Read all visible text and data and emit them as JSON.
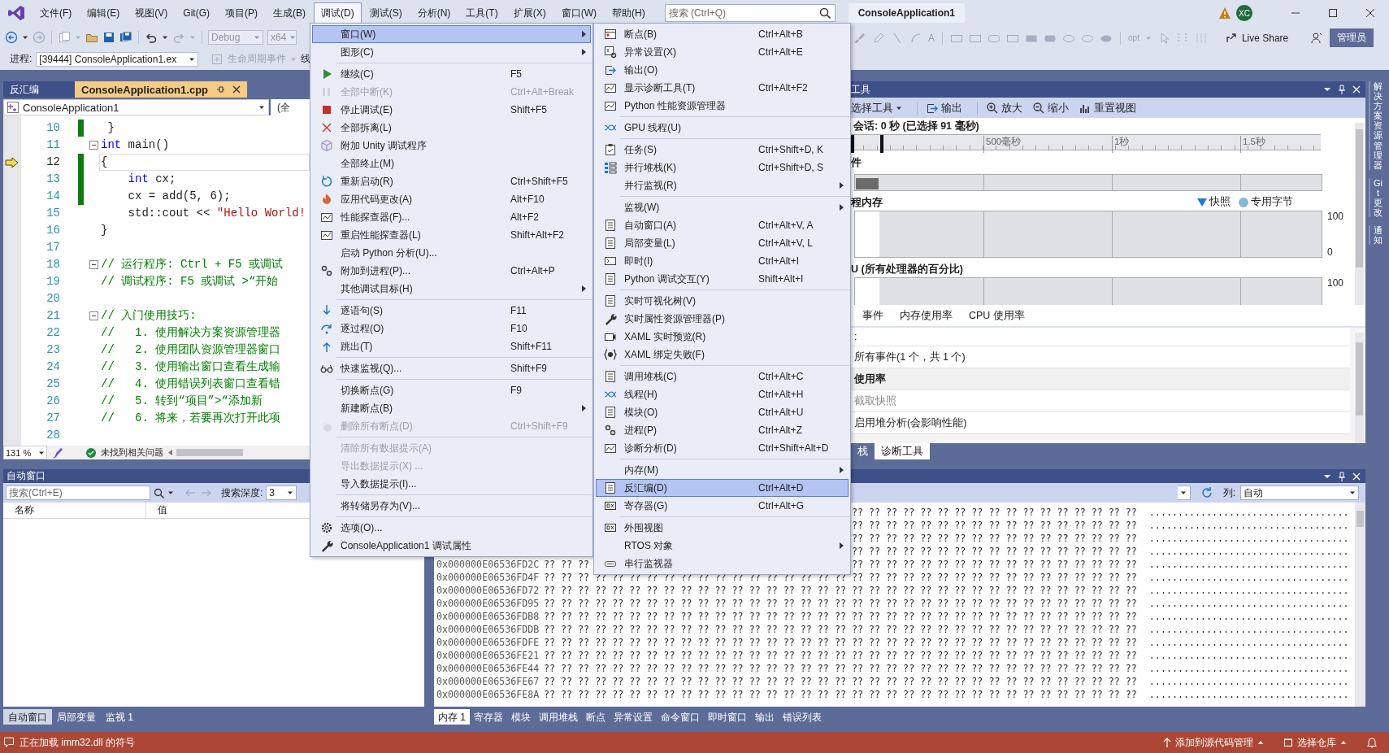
{
  "menubar": {
    "items": [
      {
        "label": "文件(F)",
        "selected": false
      },
      {
        "label": "编辑(E)",
        "selected": false
      },
      {
        "label": "视图(V)",
        "selected": false
      },
      {
        "label": "Git(G)",
        "selected": false
      },
      {
        "label": "项目(P)",
        "selected": false
      },
      {
        "label": "生成(B)",
        "selected": false
      },
      {
        "label": "调试(D)",
        "selected": true
      },
      {
        "label": "测试(S)",
        "selected": false
      },
      {
        "label": "分析(N)",
        "selected": false
      },
      {
        "label": "工具(T)",
        "selected": false
      },
      {
        "label": "扩展(X)",
        "selected": false
      },
      {
        "label": "窗口(W)",
        "selected": false
      },
      {
        "label": "帮助(H)",
        "selected": false
      }
    ],
    "search": {
      "placeholder": "搜索 (Ctrl+Q)"
    },
    "title": "ConsoleApplication1",
    "avatar": "XC"
  },
  "toolbar": {
    "configuration": {
      "value": "Debug",
      "disabled": true
    },
    "platform": {
      "value": "x64",
      "disabled": true
    },
    "design_letter": "A",
    "design_option": "opt",
    "live_share": "Live Share",
    "admin": "管理员",
    "process_label": "进程:",
    "process": "[39444] ConsoleApplication1.ex",
    "lifecycle": "生命周期事件",
    "thread_label": "线"
  },
  "editor": {
    "tabs": [
      {
        "label": "反汇编",
        "selected": false
      },
      {
        "label": "ConsoleApplication1.cpp",
        "selected": true
      }
    ],
    "scope": "ConsoleApplication1",
    "scope_2": "(全",
    "lines": [
      {
        "number": "10",
        "changed": true,
        "fold": false,
        "current": false,
        "tokens": [
          {
            "kind": "plain",
            "text": " }"
          }
        ]
      },
      {
        "number": "11",
        "changed": false,
        "fold": true,
        "current": false,
        "tokens": [
          {
            "kind": "keyword",
            "text": "int"
          },
          {
            "kind": "plain",
            "text": " main()"
          }
        ]
      },
      {
        "number": "12",
        "changed": true,
        "fold": false,
        "current": true,
        "tokens": [
          {
            "kind": "plain",
            "text": "{"
          }
        ]
      },
      {
        "number": "13",
        "changed": true,
        "fold": false,
        "current": false,
        "tokens": [
          {
            "kind": "keyword",
            "text": "    int"
          },
          {
            "kind": "plain",
            "text": " cx;"
          }
        ]
      },
      {
        "number": "14",
        "changed": true,
        "fold": false,
        "current": false,
        "tokens": [
          {
            "kind": "plain",
            "text": "    cx = add(5, 6);"
          }
        ]
      },
      {
        "number": "15",
        "changed": false,
        "fold": false,
        "current": false,
        "tokens": [
          {
            "kind": "plain",
            "text": "    std::cout << "
          },
          {
            "kind": "string",
            "text": "\"Hello World!"
          }
        ]
      },
      {
        "number": "16",
        "changed": false,
        "fold": false,
        "current": false,
        "tokens": [
          {
            "kind": "plain",
            "text": "}"
          }
        ]
      },
      {
        "number": "17",
        "changed": false,
        "fold": false,
        "current": false
      },
      {
        "number": "18",
        "changed": false,
        "fold": true,
        "current": false,
        "tokens": [
          {
            "kind": "comment",
            "text": "// 运行程序: Ctrl + F5 或调试"
          }
        ]
      },
      {
        "number": "19",
        "changed": false,
        "fold": false,
        "current": false,
        "tokens": [
          {
            "kind": "comment",
            "text": "// 调试程序: F5 或调试 >“开始"
          }
        ]
      },
      {
        "number": "20",
        "changed": false,
        "fold": false,
        "current": false
      },
      {
        "number": "21",
        "changed": false,
        "fold": true,
        "current": false,
        "tokens": [
          {
            "kind": "comment",
            "text": "// 入门使用技巧:"
          }
        ]
      },
      {
        "number": "22",
        "changed": false,
        "fold": false,
        "current": false,
        "tokens": [
          {
            "kind": "comment",
            "text": "//   1. 使用解决方案资源管理器"
          }
        ]
      },
      {
        "number": "23",
        "changed": false,
        "fold": false,
        "current": false,
        "tokens": [
          {
            "kind": "comment",
            "text": "//   2. 使用团队资源管理器窗口"
          }
        ]
      },
      {
        "number": "24",
        "changed": false,
        "fold": false,
        "current": false,
        "tokens": [
          {
            "kind": "comment",
            "text": "//   3. 使用输出窗口查看生成输"
          }
        ]
      },
      {
        "number": "25",
        "changed": false,
        "fold": false,
        "current": false,
        "tokens": [
          {
            "kind": "comment",
            "text": "//   4. 使用错误列表窗口查看错"
          }
        ]
      },
      {
        "number": "26",
        "changed": false,
        "fold": false,
        "current": false,
        "tokens": [
          {
            "kind": "comment",
            "text": "//   5. 转到“项目”>“添加新"
          }
        ]
      },
      {
        "number": "27",
        "changed": false,
        "fold": false,
        "current": false,
        "tokens": [
          {
            "kind": "comment",
            "text": "//   6. 将来，若要再次打开此项"
          }
        ]
      },
      {
        "number": "28",
        "changed": false,
        "fold": false,
        "current": false
      }
    ],
    "zoom": "131 %",
    "issues": "未找到相关问题"
  },
  "diagnostics": {
    "title": "工具",
    "toolbar": [
      "选择工具",
      "输出",
      "放大",
      "缩小",
      "重置视图"
    ],
    "session": "会话: 0 秒 (已选择 91 毫秒)",
    "ruler_labels": [
      "500毫秒",
      "1秒",
      "1.5秒"
    ],
    "events_heading": "件",
    "memory_heading": "程内存",
    "legend": [
      {
        "label": "快照",
        "color": "#1e7bd6"
      },
      {
        "label": "专用字节",
        "color": "#86b7d6"
      }
    ],
    "memory_axis": [
      "100",
      "0"
    ],
    "cpu_heading": "U (所有处理器的百分比)",
    "cpu_axis": [
      "100"
    ],
    "tabs": [
      {
        "label": "事件",
        "selected": false
      },
      {
        "label": "内存使用率",
        "selected": false
      },
      {
        "label": "CPU 使用率",
        "selected": false
      }
    ],
    "list": [
      {
        "kind": "row",
        "text": ":"
      },
      {
        "kind": "row",
        "text": "所有事件(1 个，共 1 个)"
      },
      {
        "kind": "heading",
        "text": "使用率"
      },
      {
        "kind": "action",
        "text": "截取快照",
        "disabled": true
      },
      {
        "kind": "action",
        "text": "启用堆分析(会影响性能)",
        "disabled": false
      }
    ],
    "bottom_tabs": [
      {
        "label": "栈",
        "selected": false
      },
      {
        "label": "诊断工具",
        "selected": true
      }
    ]
  },
  "side_tabs": [
    "解决方案资源管理器",
    "Git 更改",
    "通知"
  ],
  "autos": {
    "title": "自动窗口",
    "search": {
      "placeholder": "搜索(Ctrl+E)"
    },
    "depth_label": "搜索深度:",
    "depth": "3",
    "columns": [
      "名称",
      "值"
    ],
    "tabs": [
      {
        "label": "自动窗口",
        "selected": true
      },
      {
        "label": "局部变量",
        "selected": false
      },
      {
        "label": "监视 1",
        "selected": false
      }
    ]
  },
  "memory": {
    "columns_label": "列:",
    "columns_value": "自动",
    "rows": [
      {
        "bytes": "?? ?? ?? ?? ?? ?? ?? ?? ?? ?? ?? ?? ?? ?? ?? ?? ??",
        "chars": "..................................."
      },
      {
        "bytes": "?? ?? ?? ?? ?? ?? ?? ?? ?? ?? ?? ?? ?? ?? ?? ?? ??",
        "chars": "..................................."
      },
      {
        "bytes": "?? ?? ?? ?? ?? ?? ?? ?? ?? ?? ?? ?? ?? ?? ?? ?? ??",
        "chars": "..................................."
      },
      {
        "bytes": "?? ?? ?? ?? ?? ?? ?? ?? ?? ?? ?? ?? ?? ?? ?? ?? ??",
        "chars": "..................................."
      },
      {
        "address": "0x000000E06536FD2C",
        "bytes_left": "?? ?? ??",
        "bytes": "?? ?? ?? ?? ?? ?? ?? ?? ?? ?? ?? ?? ?? ?? ?? ?? ??",
        "chars": "..................................."
      },
      {
        "address": "0x000000E06536FD4F",
        "bytes": "?? ?? ?? ?? ?? ?? ?? ?? ?? ?? ?? ?? ?? ?? ?? ?? ?? ?? ?? ?? ?? ?? ?? ?? ?? ?? ?? ?? ?? ?? ?? ?? ?? ?? ??",
        "chars": "..................................."
      },
      {
        "address": "0x000000E06536FD72",
        "bytes": "?? ?? ?? ?? ?? ?? ?? ?? ?? ?? ?? ?? ?? ?? ?? ?? ?? ?? ?? ?? ?? ?? ?? ?? ?? ?? ?? ?? ?? ?? ?? ?? ?? ?? ??",
        "chars": "..................................."
      },
      {
        "address": "0x000000E06536FD95",
        "bytes": "?? ?? ?? ?? ?? ?? ?? ?? ?? ?? ?? ?? ?? ?? ?? ?? ?? ?? ?? ?? ?? ?? ?? ?? ?? ?? ?? ?? ?? ?? ?? ?? ?? ?? ??",
        "chars": "..................................."
      },
      {
        "address": "0x000000E06536FDB8",
        "bytes": "?? ?? ?? ?? ?? ?? ?? ?? ?? ?? ?? ?? ?? ?? ?? ?? ?? ?? ?? ?? ?? ?? ?? ?? ?? ?? ?? ?? ?? ?? ?? ?? ?? ?? ??",
        "chars": "..................................."
      },
      {
        "address": "0x000000E06536FDDB",
        "bytes": "?? ?? ?? ?? ?? ?? ?? ?? ?? ?? ?? ?? ?? ?? ?? ?? ?? ?? ?? ?? ?? ?? ?? ?? ?? ?? ?? ?? ?? ?? ?? ?? ?? ?? ??",
        "chars": "..................................."
      },
      {
        "address": "0x000000E06536FDFE",
        "bytes": "?? ?? ?? ?? ?? ?? ?? ?? ?? ?? ?? ?? ?? ?? ?? ?? ?? ?? ?? ?? ?? ?? ?? ?? ?? ?? ?? ?? ?? ?? ?? ?? ?? ?? ??",
        "chars": "..................................."
      },
      {
        "address": "0x000000E06536FE21",
        "bytes": "?? ?? ?? ?? ?? ?? ?? ?? ?? ?? ?? ?? ?? ?? ?? ?? ?? ?? ?? ?? ?? ?? ?? ?? ?? ?? ?? ?? ?? ?? ?? ?? ?? ?? ??",
        "chars": "..................................."
      },
      {
        "address": "0x000000E06536FE44",
        "bytes": "?? ?? ?? ?? ?? ?? ?? ?? ?? ?? ?? ?? ?? ?? ?? ?? ?? ?? ?? ?? ?? ?? ?? ?? ?? ?? ?? ?? ?? ?? ?? ?? ?? ?? ??",
        "chars": "..................................."
      },
      {
        "address": "0x000000E06536FE67",
        "bytes": "?? ?? ?? ?? ?? ?? ?? ?? ?? ?? ?? ?? ?? ?? ?? ?? ?? ?? ?? ?? ?? ?? ?? ?? ?? ?? ?? ?? ?? ?? ?? ?? ?? ?? ??",
        "chars": "..................................."
      },
      {
        "address": "0x000000E06536FE8A",
        "bytes": "?? ?? ?? ?? ?? ?? ?? ?? ?? ?? ?? ?? ?? ?? ?? ?? ?? ?? ?? ?? ?? ?? ?? ?? ?? ?? ?? ?? ?? ?? ?? ?? ?? ?? ??",
        "chars": "..................................."
      }
    ],
    "tabs": [
      {
        "label": "内存 1",
        "selected": true
      },
      {
        "label": "寄存器",
        "selected": false
      },
      {
        "label": "模块",
        "selected": false
      },
      {
        "label": "调用堆栈",
        "selected": false
      },
      {
        "label": "断点",
        "selected": false
      },
      {
        "label": "异常设置",
        "selected": false
      },
      {
        "label": "命令窗口",
        "selected": false
      },
      {
        "label": "即时窗口",
        "selected": false
      },
      {
        "label": "输出",
        "selected": false
      },
      {
        "label": "错误列表",
        "selected": false
      }
    ]
  },
  "status_bar": {
    "message": "正在加载 imm32.dll 的符号",
    "source_control": "添加到源代码管理",
    "repository": "选择仓库"
  },
  "debug_menu": {
    "items": [
      {
        "kind": "item",
        "label": "窗口(W)",
        "submenu": true,
        "selected": true,
        "disabled": false
      },
      {
        "kind": "item",
        "label": "图形(C)",
        "submenu": true,
        "selected": false,
        "disabled": false
      },
      {
        "kind": "separator"
      },
      {
        "kind": "item",
        "label": "继续(C)",
        "shortcut": "F5",
        "selected": false,
        "disabled": false
      },
      {
        "kind": "item",
        "label": "全部中断(K)",
        "shortcut": "Ctrl+Alt+Break",
        "selected": false,
        "disabled": true
      },
      {
        "kind": "item",
        "label": "停止调试(E)",
        "shortcut": "Shift+F5",
        "selected": false,
        "disabled": false
      },
      {
        "kind": "item",
        "label": "全部拆离(L)",
        "selected": false,
        "disabled": false
      },
      {
        "kind": "item",
        "label": "附加 Unity 调试程序",
        "selected": false,
        "disabled": false
      },
      {
        "kind": "item",
        "label": "全部终止(M)",
        "selected": false,
        "disabled": false
      },
      {
        "kind": "item",
        "label": "重新启动(R)",
        "shortcut": "Ctrl+Shift+F5",
        "selected": false,
        "disabled": false
      },
      {
        "kind": "item",
        "label": "应用代码更改(A)",
        "shortcut": "Alt+F10",
        "selected": false,
        "disabled": false
      },
      {
        "kind": "item",
        "label": "性能探查器(F)...",
        "shortcut": "Alt+F2",
        "selected": false,
        "disabled": false
      },
      {
        "kind": "item",
        "label": "重启性能探查器(L)",
        "shortcut": "Shift+Alt+F2",
        "selected": false,
        "disabled": false
      },
      {
        "kind": "item",
        "label": "启动 Python 分析(U)...",
        "selected": false,
        "disabled": false
      },
      {
        "kind": "item",
        "label": "附加到进程(P)...",
        "shortcut": "Ctrl+Alt+P",
        "selected": false,
        "disabled": false
      },
      {
        "kind": "item",
        "label": "其他调试目标(H)",
        "submenu": true,
        "selected": false,
        "disabled": false
      },
      {
        "kind": "separator"
      },
      {
        "kind": "item",
        "label": "逐语句(S)",
        "shortcut": "F11",
        "selected": false,
        "disabled": false
      },
      {
        "kind": "item",
        "label": "逐过程(O)",
        "shortcut": "F10",
        "selected": false,
        "disabled": false
      },
      {
        "kind": "item",
        "label": "跳出(T)",
        "shortcut": "Shift+F11",
        "selected": false,
        "disabled": false
      },
      {
        "kind": "separator"
      },
      {
        "kind": "item",
        "label": "快速监视(Q)...",
        "shortcut": "Shift+F9",
        "selected": false,
        "disabled": false
      },
      {
        "kind": "separator"
      },
      {
        "kind": "item",
        "label": "切换断点(G)",
        "shortcut": "F9",
        "selected": false,
        "disabled": false
      },
      {
        "kind": "item",
        "label": "新建断点(B)",
        "submenu": true,
        "selected": false,
        "disabled": false
      },
      {
        "kind": "item",
        "label": "删除所有断点(D)",
        "shortcut": "Ctrl+Shift+F9",
        "selected": false,
        "disabled": true
      },
      {
        "kind": "separator"
      },
      {
        "kind": "item",
        "label": "清除所有数据提示(A)",
        "selected": false,
        "disabled": true
      },
      {
        "kind": "item",
        "label": "导出数据提示(X) ...",
        "selected": false,
        "disabled": true
      },
      {
        "kind": "item",
        "label": "导入数据提示(I)...",
        "selected": false,
        "disabled": false
      },
      {
        "kind": "separator"
      },
      {
        "kind": "item",
        "label": "将转储另存为(V)...",
        "selected": false,
        "disabled": false
      },
      {
        "kind": "separator"
      },
      {
        "kind": "item",
        "label": "选项(O)...",
        "selected": false,
        "disabled": false
      },
      {
        "kind": "item",
        "label": "ConsoleApplication1 调试属性",
        "selected": false,
        "disabled": false
      }
    ]
  },
  "window_submenu": {
    "items": [
      {
        "kind": "item",
        "label": "断点(B)",
        "shortcut": "Ctrl+Alt+B",
        "selected": false,
        "disabled": false
      },
      {
        "kind": "item",
        "label": "异常设置(X)",
        "shortcut": "Ctrl+Alt+E",
        "selected": false,
        "disabled": false
      },
      {
        "kind": "item",
        "label": "输出(O)",
        "selected": false,
        "disabled": false
      },
      {
        "kind": "item",
        "label": "显示诊断工具(T)",
        "shortcut": "Ctrl+Alt+F2",
        "selected": false,
        "disabled": false
      },
      {
        "kind": "item",
        "label": "Python 性能资源管理器",
        "selected": false,
        "disabled": false
      },
      {
        "kind": "separator"
      },
      {
        "kind": "item",
        "label": "GPU 线程(U)",
        "selected": false,
        "disabled": false
      },
      {
        "kind": "separator"
      },
      {
        "kind": "item",
        "label": "任务(S)",
        "shortcut": "Ctrl+Shift+D, K",
        "selected": false,
        "disabled": false
      },
      {
        "kind": "item",
        "label": "并行堆栈(K)",
        "shortcut": "Ctrl+Shift+D, S",
        "selected": false,
        "disabled": false
      },
      {
        "kind": "item",
        "label": "并行监视(R)",
        "submenu": true,
        "selected": false,
        "disabled": false
      },
      {
        "kind": "separator"
      },
      {
        "kind": "item",
        "label": "监视(W)",
        "submenu": true,
        "selected": false,
        "disabled": false
      },
      {
        "kind": "item",
        "label": "自动窗口(A)",
        "shortcut": "Ctrl+Alt+V, A",
        "selected": false,
        "disabled": false
      },
      {
        "kind": "item",
        "label": "局部变量(L)",
        "shortcut": "Ctrl+Alt+V, L",
        "selected": false,
        "disabled": false
      },
      {
        "kind": "item",
        "label": "即时(I)",
        "shortcut": "Ctrl+Alt+I",
        "selected": false,
        "disabled": false
      },
      {
        "kind": "item",
        "label": "Python 调试交互(Y)",
        "shortcut": "Shift+Alt+I",
        "selected": false,
        "disabled": false
      },
      {
        "kind": "separator"
      },
      {
        "kind": "item",
        "label": "实时可视化树(V)",
        "selected": false,
        "disabled": false
      },
      {
        "kind": "item",
        "label": "实时属性资源管理器(P)",
        "selected": false,
        "disabled": false
      },
      {
        "kind": "item",
        "label": "XAML 实时预览(R)",
        "selected": false,
        "disabled": false
      },
      {
        "kind": "item",
        "label": "XAML 绑定失败(F)",
        "selected": false,
        "disabled": false
      },
      {
        "kind": "separator"
      },
      {
        "kind": "item",
        "label": "调用堆栈(C)",
        "shortcut": "Ctrl+Alt+C",
        "selected": false,
        "disabled": false
      },
      {
        "kind": "item",
        "label": "线程(H)",
        "shortcut": "Ctrl+Alt+H",
        "selected": false,
        "disabled": false
      },
      {
        "kind": "item",
        "label": "模块(O)",
        "shortcut": "Ctrl+Alt+U",
        "selected": false,
        "disabled": false
      },
      {
        "kind": "item",
        "label": "进程(P)",
        "shortcut": "Ctrl+Alt+Z",
        "selected": false,
        "disabled": false
      },
      {
        "kind": "item",
        "label": "诊断分析(D)",
        "shortcut": "Ctrl+Shift+Alt+D",
        "selected": false,
        "disabled": false
      },
      {
        "kind": "separator"
      },
      {
        "kind": "item",
        "label": "内存(M)",
        "submenu": true,
        "selected": false,
        "disabled": false
      },
      {
        "kind": "item",
        "label": "反汇编(D)",
        "shortcut": "Ctrl+Alt+D",
        "selected": true,
        "disabled": false
      },
      {
        "kind": "item",
        "label": "寄存器(G)",
        "shortcut": "Ctrl+Alt+G",
        "selected": false,
        "disabled": false
      },
      {
        "kind": "separator"
      },
      {
        "kind": "item",
        "label": "外围视图",
        "selected": false,
        "disabled": false
      },
      {
        "kind": "item",
        "label": "RTOS 对象",
        "submenu": true,
        "selected": false,
        "disabled": false
      },
      {
        "kind": "item",
        "label": "串行监视器",
        "selected": false,
        "disabled": false
      }
    ]
  }
}
